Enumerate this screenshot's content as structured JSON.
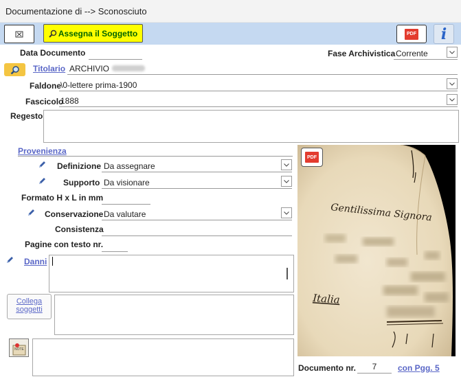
{
  "window": {
    "title": "Documentazione di -->  Sconosciuto"
  },
  "toolbar": {
    "assign_label": "Assegna il Soggetto",
    "pdf_label": "PDF",
    "info_label": "i"
  },
  "form": {
    "data_documento": {
      "label": "Data Documento",
      "value": ""
    },
    "fase_archivistica": {
      "label": "Fase Archivistica",
      "value": "Corrente"
    },
    "titolario": {
      "label": "Titolario",
      "value": "ARCHIVIO"
    },
    "faldone": {
      "label": "Faldone",
      "value": "\\0-lettere prima-1900"
    },
    "fascicolo": {
      "label": "Fascicolo",
      "value": "1888"
    },
    "regesto": {
      "label": "Regesto",
      "value": ""
    },
    "provenienza": {
      "label": "Provenienza"
    },
    "definizione": {
      "label": "Definizione",
      "value": "Da assegnare"
    },
    "supporto": {
      "label": "Supporto",
      "value": "Da visionare"
    },
    "formato": {
      "label": "Formato H x L in mm",
      "value": ""
    },
    "conservazione": {
      "label": "Conservazione",
      "value": "Da valutare"
    },
    "consistenza": {
      "label": "Consistenza",
      "value": ""
    },
    "pagine": {
      "label": "Pagine con testo nr.",
      "value": ""
    },
    "danni": {
      "label": "Danni",
      "value": ""
    },
    "collega": {
      "label_line1": "Collega",
      "label_line2": "soggetti"
    },
    "note_icon_label": "NOTE"
  },
  "document": {
    "label": "Documento nr.",
    "number": "7",
    "pages_link": "con Pgg. 5"
  },
  "image": {
    "pdf_badge_label": "PDF",
    "handwriting_line1": "Gentilissima Signora",
    "handwriting_line2": "Italia"
  },
  "colors": {
    "toolbar_bg": "#c5d9f1",
    "assign_bg": "#ffff00",
    "assign_text": "#006400",
    "link": "#5a67c7",
    "pdf_red": "#e33b2e"
  }
}
